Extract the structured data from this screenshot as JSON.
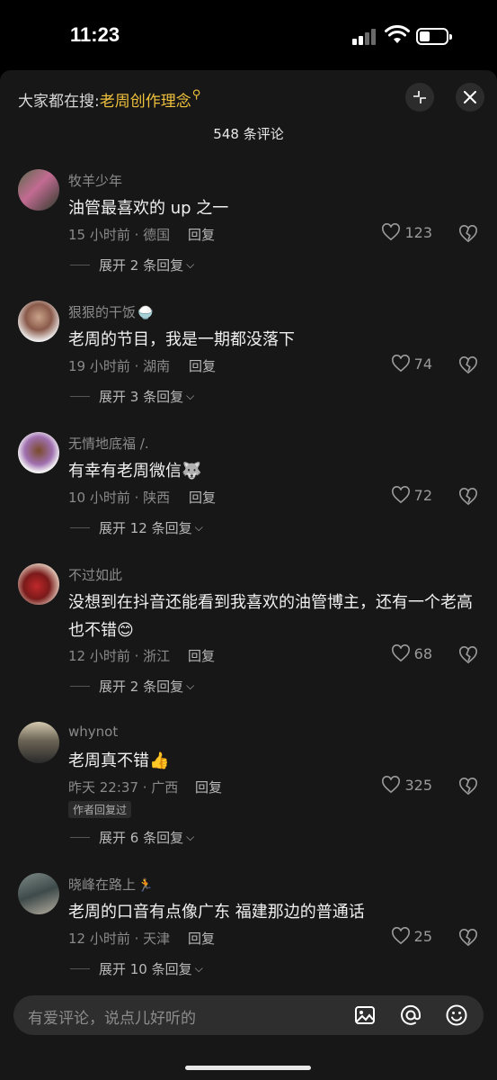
{
  "status": {
    "time": "11:23"
  },
  "header": {
    "search_prefix": "大家都在搜:",
    "search_keyword": "老周创作理念",
    "comment_count": "548 条评论"
  },
  "comments": [
    {
      "user": "牧羊少年",
      "text": "油管最喜欢的 up 之一",
      "meta": "15 小时前 · 德国",
      "reply": "回复",
      "likes": "123",
      "expand": "展开 2 条回复"
    },
    {
      "user": "狠狠的干饭",
      "text": "老周的节目，我是一期都没落下",
      "meta": "19 小时前 · 湖南",
      "reply": "回复",
      "likes": "74",
      "expand": "展开 3 条回复"
    },
    {
      "user": "无情地底福 /.",
      "text": "有幸有老周微信",
      "meta": "10 小时前 · 陕西",
      "reply": "回复",
      "likes": "72",
      "expand": "展开 12 条回复"
    },
    {
      "user": "不过如此",
      "text": "没想到在抖音还能看到我喜欢的油管博主，还有一个老高也不错",
      "meta": "12 小时前 · 浙江",
      "reply": "回复",
      "likes": "68",
      "expand": "展开 2 条回复"
    },
    {
      "user": "whynot",
      "text": "老周真不错",
      "meta": "昨天 22:37 · 广西",
      "reply": "回复",
      "likes": "325",
      "badge": "作者回复过",
      "expand": "展开 6 条回复"
    },
    {
      "user": "晓峰在路上",
      "text": "老周的口音有点像广东 福建那边的普通话",
      "meta": "12 小时前 · 天津",
      "reply": "回复",
      "likes": "25",
      "expand": "展开 10 条回复"
    }
  ],
  "input": {
    "placeholder": "有爱评论，说点儿好听的"
  },
  "icons": [
    "collapse-icon",
    "close-icon",
    "heart-icon",
    "dislike-heart-icon",
    "image-icon",
    "at-icon",
    "emoji-icon"
  ],
  "colors": {
    "accent": "#f0c23c",
    "sheet": "#171717"
  }
}
